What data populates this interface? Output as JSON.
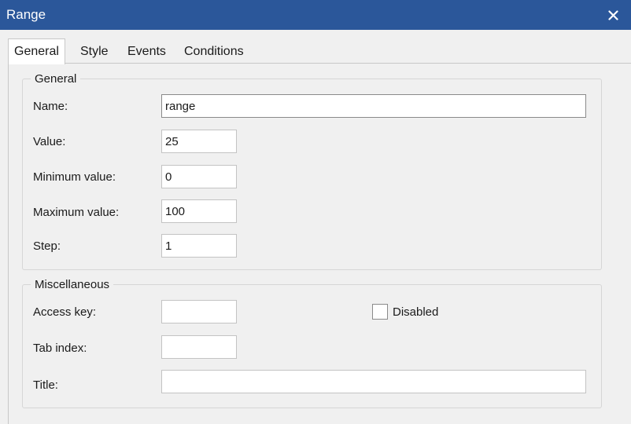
{
  "window": {
    "title": "Range",
    "close_glyph": "✕"
  },
  "tabs": [
    {
      "label": "General",
      "active": true
    },
    {
      "label": "Style",
      "active": false
    },
    {
      "label": "Events",
      "active": false
    },
    {
      "label": "Conditions",
      "active": false
    }
  ],
  "general": {
    "legend": "General",
    "name": {
      "label": "Name:",
      "value": "range"
    },
    "value": {
      "label": "Value:",
      "value": "25"
    },
    "min": {
      "label": "Minimum value:",
      "value": "0"
    },
    "max": {
      "label": "Maximum value:",
      "value": "100"
    },
    "step": {
      "label": "Step:",
      "value": "1"
    }
  },
  "misc": {
    "legend": "Miscellaneous",
    "access_key": {
      "label": "Access key:",
      "value": ""
    },
    "tab_index": {
      "label": "Tab index:",
      "value": ""
    },
    "title": {
      "label": "Title:",
      "value": ""
    },
    "disabled": {
      "label": "Disabled",
      "checked": false
    }
  },
  "colors": {
    "titlebar": "#2b579a",
    "background": "#f0f0f0"
  },
  "icons": {
    "close": "close-icon",
    "checkbox": "checkbox-icon"
  }
}
